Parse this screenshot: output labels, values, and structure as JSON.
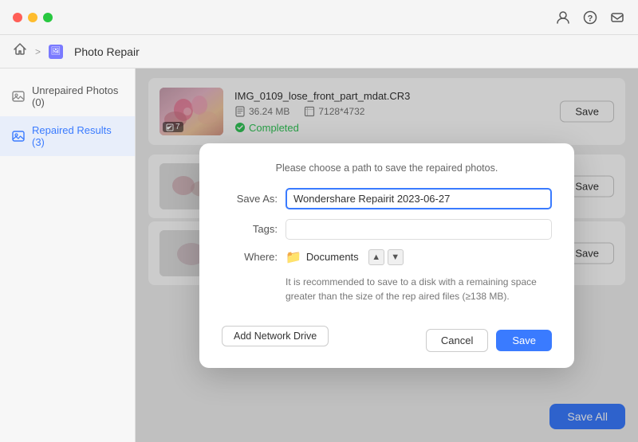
{
  "window": {
    "title": "Photo Repair"
  },
  "titlebar": {
    "icons": [
      "user-icon",
      "help-icon",
      "mail-icon"
    ]
  },
  "navbar": {
    "home_label": "🏠",
    "breadcrumb_icon": "🖼",
    "page_title": "Photo Repair"
  },
  "sidebar": {
    "items": [
      {
        "id": "unrepaired",
        "label": "Unrepaired Photos (0)",
        "active": false
      },
      {
        "id": "repaired",
        "label": "Repaired Results (3)",
        "active": true
      }
    ]
  },
  "photos": [
    {
      "name": "IMG_0109_lose_front_part_mdat.CR3",
      "size": "36.24 MB",
      "dimensions": "7128*4732",
      "status": "Completed",
      "badge": "7"
    }
  ],
  "buttons": {
    "save_label": "Save",
    "save_all_label": "Save All"
  },
  "modal": {
    "hint": "Please choose a path to save the repaired photos.",
    "save_as_label": "Save As:",
    "save_as_value": "Wondershare Repairit 2023-06-27",
    "tags_label": "Tags:",
    "where_label": "Where:",
    "where_folder": "Documents",
    "disk_hint": "It is recommended to save to a disk with a remaining space greater than the size of the rep aired files (≥138 MB).",
    "add_network_label": "Add Network Drive",
    "cancel_label": "Cancel",
    "save_label": "Save"
  }
}
